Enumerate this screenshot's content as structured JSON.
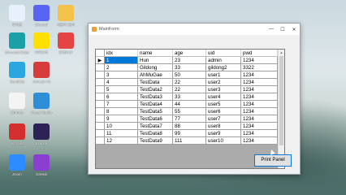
{
  "desktop": {
    "icons": [
      {
        "label": "휴지통",
        "name": "recycle-bin-icon",
        "color": "#e8f1fb"
      },
      {
        "label": "Discord",
        "name": "discord-icon",
        "color": "#5865f2"
      },
      {
        "label": "새폴더 폴더",
        "name": "folder-icon",
        "color": "#f3c24b"
      },
      {
        "label": "Microsoft Edge",
        "name": "edge-icon",
        "color": "#1aa1a7"
      },
      {
        "label": "카카오톡",
        "name": "kakaotalk-icon",
        "color": "#ffe000"
      },
      {
        "label": "한컴PDF",
        "name": "pdf-icon",
        "color": "#e54444"
      },
      {
        "label": "BandiZip",
        "name": "bandizip-icon",
        "color": "#2aa7e0"
      },
      {
        "label": "AhnLab V3",
        "name": "ahnlab-icon",
        "color": "#d73b3b"
      },
      {
        "label": "Chrome",
        "name": "chrome-icon",
        "color": "#f4f4f4"
      },
      {
        "label": "Visual Studio",
        "name": "visual-studio-icon",
        "color": "#2e8fd6"
      },
      {
        "label": "Acrobat",
        "name": "acrobat-icon",
        "color": "#d32f2f"
      },
      {
        "label": "Eclipse",
        "name": "eclipse-icon",
        "color": "#2c2255"
      },
      {
        "label": "Zoom",
        "name": "zoom-icon",
        "color": "#2d8cff"
      },
      {
        "label": "GitHub",
        "name": "github-icon",
        "color": "#8a3fd1"
      }
    ]
  },
  "window": {
    "title": "MainForm",
    "minimize": "—",
    "maximize": "☐",
    "close": "✕"
  },
  "grid": {
    "columns": [
      "idx",
      "name",
      "age",
      "uid",
      "pwd"
    ],
    "rows": [
      [
        "1",
        "Hun",
        "23",
        "admin",
        "1234"
      ],
      [
        "2",
        "Gildong",
        "33",
        "gildong2",
        "3322"
      ],
      [
        "3",
        "AhMuGae",
        "50",
        "user1",
        "1234"
      ],
      [
        "4",
        "TestData",
        "22",
        "user2",
        "1234"
      ],
      [
        "5",
        "TestData2",
        "22",
        "user3",
        "1234"
      ],
      [
        "6",
        "TestData3",
        "33",
        "user4",
        "1234"
      ],
      [
        "7",
        "TestData4",
        "44",
        "user5",
        "1234"
      ],
      [
        "8",
        "TestData5",
        "55",
        "user6",
        "1234"
      ],
      [
        "9",
        "TestData6",
        "77",
        "user7",
        "1234"
      ],
      [
        "10",
        "TestData7",
        "88",
        "user8",
        "1234"
      ],
      [
        "11",
        "TestData8",
        "99",
        "user9",
        "1234"
      ],
      [
        "12",
        "TestData9",
        "111",
        "user10",
        "1234"
      ]
    ],
    "selected_row_marker": "▶"
  },
  "print_button": "Print Panel"
}
